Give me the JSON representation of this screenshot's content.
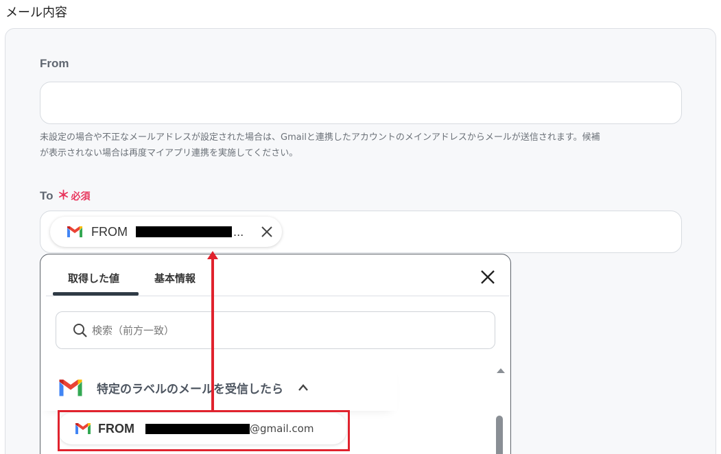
{
  "section_title": "メール内容",
  "from_field": {
    "label": "From",
    "value": "",
    "help_line1": "未設定の場合や不正なメールアドレスが設定された場合は、Gmailと連携したアカウントのメインアドレスからメールが送信されます。候補",
    "help_line2": "が表示されない場合は再度マイアプリ連携を実施してください。"
  },
  "to_field": {
    "label": "To",
    "required_star": "＊",
    "required_text": "必須",
    "chip": {
      "icon": "gmail-icon",
      "label": "FROM",
      "ellipsis": "..."
    }
  },
  "dropdown": {
    "tabs": [
      {
        "label": "取得した値",
        "active": true
      },
      {
        "label": "基本情報",
        "active": false
      }
    ],
    "search_placeholder": "検索（前方一致）",
    "group": {
      "icon": "gmail-icon",
      "title": "特定のラベルのメールを受信したら",
      "expanded": true
    },
    "option": {
      "icon": "gmail-icon",
      "label": "FROM",
      "email_suffix": "@gmail.com"
    }
  },
  "colors": {
    "required": "#e8365d",
    "annotation": "#e0222d",
    "panel_bg": "#f7f8fa"
  }
}
